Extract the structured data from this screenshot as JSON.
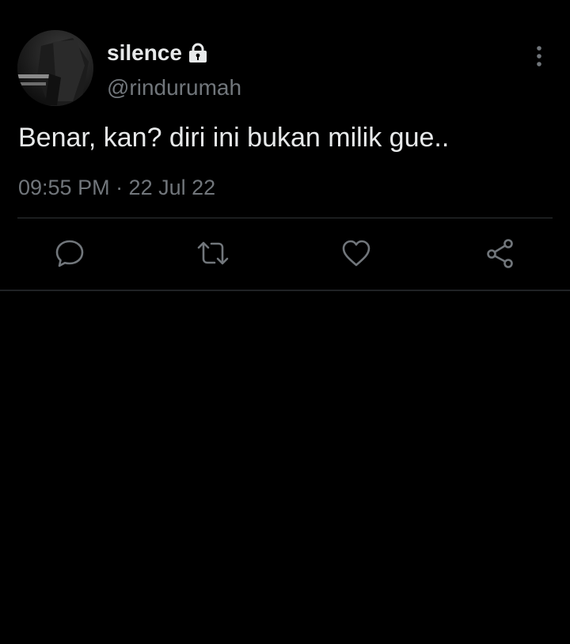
{
  "tweet": {
    "author": {
      "display_name": "silence",
      "handle": "@rindurumah",
      "protected_icon": "lock-icon",
      "avatar": "avatar"
    },
    "text": "Benar, kan? diri ini bukan milik gue..",
    "timestamp": "09:55 PM · 22 Jul 22",
    "menu_icon": "more-vertical-icon",
    "actions": [
      {
        "name": "reply",
        "icon": "reply-icon"
      },
      {
        "name": "retweet",
        "icon": "retweet-icon"
      },
      {
        "name": "like",
        "icon": "heart-icon"
      },
      {
        "name": "share",
        "icon": "share-icon"
      }
    ]
  },
  "colors": {
    "background": "#000000",
    "primary_text": "#e7e9ea",
    "secondary_text": "#71767b",
    "divider": "#2f3336"
  }
}
